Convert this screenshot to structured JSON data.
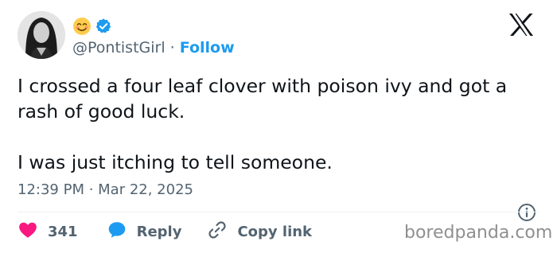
{
  "author": {
    "handle": "@PontistGirl",
    "separator": " · ",
    "follow_label": "Follow",
    "name_emoji_icon": "smiling-face-emoji-icon",
    "verified_icon": "verified-badge-icon"
  },
  "platform_icon": "x-logo-icon",
  "tweet": {
    "line1": "I crossed a four leaf clover with poison ivy and got a rash of good luck.",
    "line2": "I was just itching to tell someone.",
    "timestamp": "12:39 PM · Mar 22, 2025"
  },
  "actions": {
    "like_count": "341",
    "reply_label": "Reply",
    "copy_link_label": "Copy link"
  },
  "watermark": "boredpanda.com",
  "colors": {
    "follow": "#1d9bf0",
    "like": "#f91880",
    "reply": "#1d9bf0",
    "muted": "#536471",
    "text": "#0f1419"
  }
}
